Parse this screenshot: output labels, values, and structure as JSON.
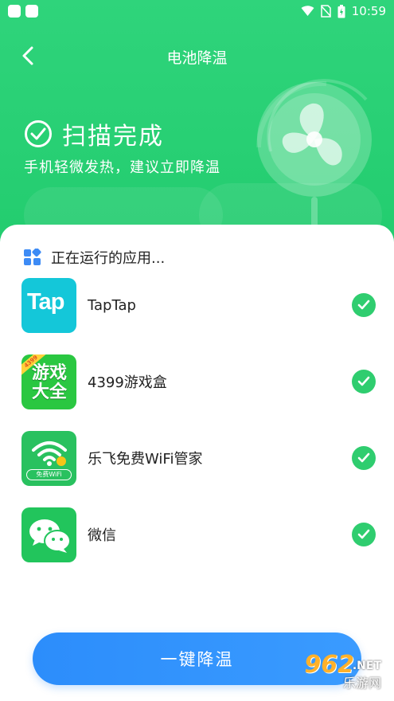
{
  "status_bar": {
    "time": "10:59"
  },
  "header": {
    "title": "电池降温",
    "scan_title": "扫描完成",
    "scan_subtitle": "手机轻微发热，建议立即降温"
  },
  "running_section": {
    "label": "正在运行的应用..."
  },
  "apps": [
    {
      "name": "TapTap",
      "icon_text": "Tap",
      "checked": true
    },
    {
      "name": "4399游戏盒",
      "icon_text": "游戏大全",
      "badge": "4399",
      "checked": true
    },
    {
      "name": "乐飞免费WiFi管家",
      "icon_text": "免费WiFi",
      "checked": true
    },
    {
      "name": "微信",
      "checked": true
    }
  ],
  "cta": {
    "label": "一键降温"
  },
  "watermark": {
    "num": "962",
    "net": ".NET",
    "site": "乐游网"
  },
  "colors": {
    "header_green": "#22cc6e",
    "check_green": "#2fcd6f",
    "cta_blue": "#2c8dfb",
    "taptap_cyan": "#14c7d9"
  }
}
